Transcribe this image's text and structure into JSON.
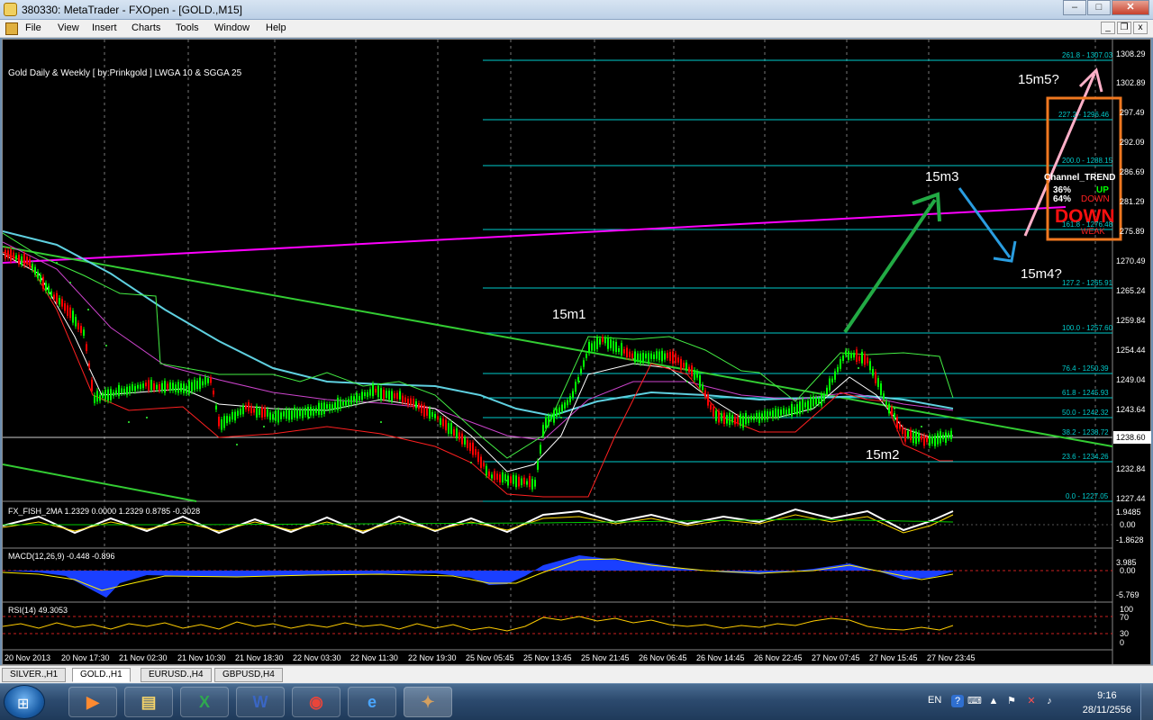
{
  "window": {
    "title": "380330: MetaTrader - FXOpen - [GOLD.,M15]"
  },
  "menu": [
    "File",
    "View",
    "Insert",
    "Charts",
    "Tools",
    "Window",
    "Help"
  ],
  "chart": {
    "header": "Gold Daily & Weekly [ by:Prinkgold ]  LWGA 10  &  SGGA 25",
    "price_scale": [
      "1308.29",
      "1302.89",
      "297.49",
      "292.09",
      "286.69",
      "281.29",
      "275.89",
      "1270.49",
      "1265.24",
      "1259.84",
      "1254.44",
      "1249.04",
      "1243.64",
      "1238.60",
      "1232.84",
      "1227.44"
    ],
    "current_price": "1238.60",
    "time_labels": [
      "20 Nov 2013",
      "20 Nov 17:30",
      "21 Nov 02:30",
      "21 Nov 10:30",
      "21 Nov 18:30",
      "22 Nov 03:30",
      "22 Nov 11:30",
      "22 Nov 19:30",
      "25 Nov 05:45",
      "25 Nov 13:45",
      "25 Nov 21:45",
      "26 Nov 06:45",
      "26 Nov 14:45",
      "26 Nov 22:45",
      "27 Nov 07:45",
      "27 Nov 15:45",
      "27 Nov 23:45"
    ],
    "fib_levels": [
      "261.8 - 1307.03",
      "227.2 - 1296.46",
      "200.0 - 1288.15",
      "161.8 - 1276.48",
      "127.2 - 1265.91",
      "100.0 - 1257.60",
      "76.4 - 1250.39",
      "61.8 - 1245.93",
      "50.0 - 1242.32",
      "38.2 - 1238.72",
      "23.6 - 1234.26",
      "0.0 - 1227.05"
    ],
    "annotations": {
      "m1": "15m1",
      "m2": "15m2",
      "m3": "15m3",
      "m4": "15m4?",
      "m5": "15m5?"
    },
    "trend_panel": {
      "title": "Channel_TREND",
      "up_pct": "36%",
      "up_label": "UP",
      "down_pct": "64%",
      "down_label": "DOWN",
      "big": "DOWN",
      "sub": "WEAK"
    },
    "colors": {
      "background": "#000000",
      "bull_candle": "#00ff00",
      "bear_candle": "#ff0000",
      "fib": "#00cccc",
      "trendline": "#33cc33",
      "magenta_line": "#ff00ff",
      "arrow_up": "#22aa44",
      "arrow_down": "#2a9de0",
      "arrow_target": "#ffb0c8",
      "box": "#f07820"
    }
  },
  "indicators": {
    "fisher": {
      "label": "FX_FISH_2MA 1.2329 0.0000 1.2329 0.8785 -0.3028",
      "scale": [
        "1.9485",
        "0.00",
        "-1.8628"
      ]
    },
    "macd": {
      "label": "MACD(12,26,9) -0.448 -0.896",
      "scale": [
        "3.985",
        "0.00",
        "-5.769"
      ]
    },
    "rsi": {
      "label": "RSI(14) 49.3053",
      "scale": [
        "100",
        "70",
        "30",
        "0"
      ]
    }
  },
  "tabs": [
    "SILVER.,H1",
    "GOLD.,H1",
    "EURUSD.,H4",
    "GBPUSD,H4"
  ],
  "active_tab": 1,
  "taskbar": {
    "lang": "EN",
    "time": "9:16",
    "date": "28/11/2556"
  }
}
